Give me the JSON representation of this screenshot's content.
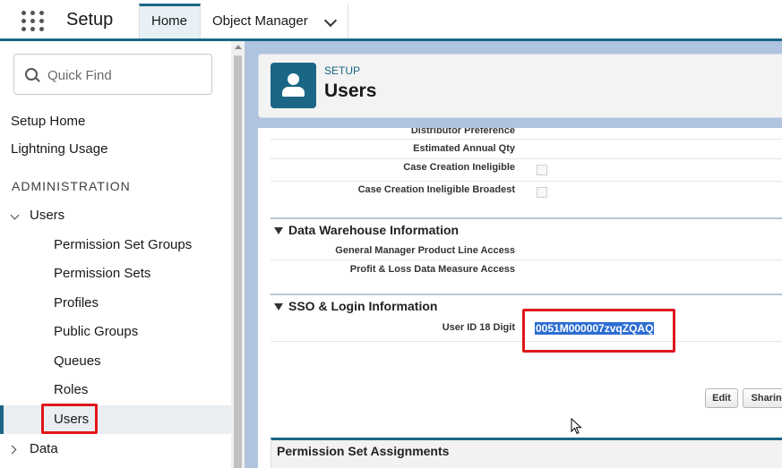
{
  "header": {
    "app_title": "Setup",
    "tabs": [
      {
        "label": "Home"
      },
      {
        "label": "Object Manager"
      }
    ]
  },
  "sidebar": {
    "search_placeholder": "Quick Find",
    "top_links": [
      "Setup Home",
      "Lightning Usage"
    ],
    "section_heading": "ADMINISTRATION",
    "users_group": "Users",
    "users_children": [
      "Permission Set Groups",
      "Permission Sets",
      "Profiles",
      "Public Groups",
      "Queues",
      "Roles",
      "Users"
    ],
    "data_group": "Data"
  },
  "page": {
    "breadcrumb": "SETUP",
    "title": "Users"
  },
  "fields_top": [
    {
      "label": "Distributor Preference"
    },
    {
      "label": "Estimated Annual Qty"
    },
    {
      "label": "Case Creation Ineligible",
      "checkbox": true
    },
    {
      "label": "Case Creation Ineligible Broadest",
      "checkbox": true
    }
  ],
  "sections": {
    "data_warehouse": {
      "title": "Data Warehouse Information",
      "fields": [
        "General Manager Product Line Access",
        "Profit & Loss Data Measure Access"
      ]
    },
    "sso": {
      "title": "SSO & Login Information",
      "field_label": "User ID 18 Digit",
      "field_value": "0051M000007zvqZQAQ"
    }
  },
  "buttons": {
    "edit": "Edit",
    "sharing": "Sharing"
  },
  "related": {
    "permission_set_assignments": "Permission Set Assignments"
  },
  "colors": {
    "brand": "#1b6685",
    "highlight_box": "#e0161b",
    "selection": "#2c6dd1"
  }
}
